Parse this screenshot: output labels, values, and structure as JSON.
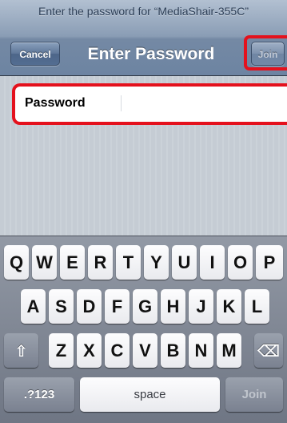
{
  "header": {
    "prompt": "Enter the password for “MediaShair-355C”",
    "title": "Enter Password",
    "cancel_label": "Cancel",
    "join_label": "Join"
  },
  "form": {
    "password_label": "Password",
    "password_value": ""
  },
  "keyboard": {
    "row1": [
      "Q",
      "W",
      "E",
      "R",
      "T",
      "Y",
      "U",
      "I",
      "O",
      "P"
    ],
    "row2": [
      "A",
      "S",
      "D",
      "F",
      "G",
      "H",
      "J",
      "K",
      "L"
    ],
    "row3": [
      "Z",
      "X",
      "C",
      "V",
      "B",
      "N",
      "M"
    ],
    "shift_icon": "shift-arrow-icon",
    "shift_glyph": "⇧",
    "delete_icon": "backspace-icon",
    "delete_glyph": "⌫",
    "numbers_label": ".?123",
    "space_label": "space",
    "join_label": "Join"
  },
  "colors": {
    "highlight": "#e4111d",
    "nav_bar": "#6d84a2",
    "background": "#c5ccd4",
    "keyboard": "#7a8190"
  }
}
